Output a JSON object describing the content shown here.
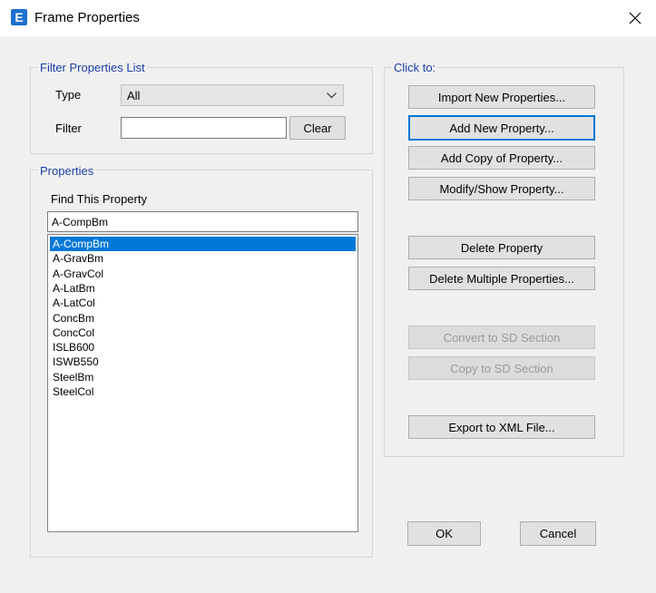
{
  "window": {
    "title": "Frame Properties",
    "icon_letter": "E",
    "close_icon": "close-icon"
  },
  "filter_group": {
    "title": "Filter Properties List",
    "type_label": "Type",
    "type_value": "All",
    "filter_label": "Filter",
    "filter_value": "",
    "clear_label": "Clear"
  },
  "properties_group": {
    "title": "Properties",
    "find_label": "Find This Property",
    "find_value": "A-CompBm",
    "items": [
      "A-CompBm",
      "A-GravBm",
      "A-GravCol",
      "A-LatBm",
      "A-LatCol",
      "ConcBm",
      "ConcCol",
      "ISLB600",
      "ISWB550",
      "SteelBm",
      "SteelCol"
    ],
    "selected": "A-CompBm"
  },
  "click_group": {
    "title": "Click to:",
    "import_label": "Import New Properties...",
    "add_label": "Add New Property...",
    "add_copy_label": "Add Copy of Property...",
    "modify_label": "Modify/Show Property...",
    "delete_label": "Delete Property",
    "delete_multiple_label": "Delete Multiple Properties...",
    "convert_label": "Convert to SD Section",
    "copy_sd_label": "Copy to SD Section",
    "export_label": "Export to XML File..."
  },
  "footer": {
    "ok_label": "OK",
    "cancel_label": "Cancel"
  },
  "colors": {
    "accent": "#0078d7",
    "group_title": "#1a3fa6",
    "dialog_bg": "#f0f0f0"
  }
}
